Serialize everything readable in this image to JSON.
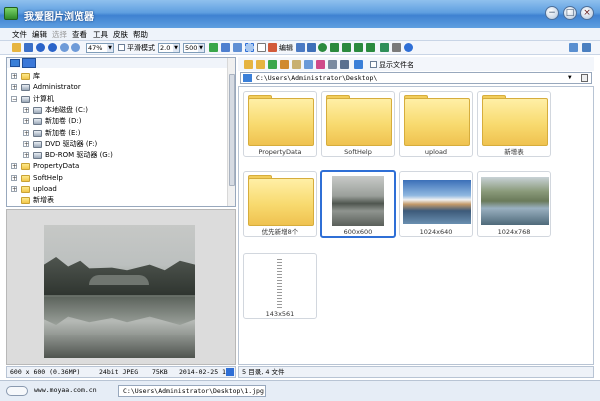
{
  "window": {
    "title": "我爱图片浏览器",
    "controls": [
      "−",
      "□",
      "×"
    ]
  },
  "menu": [
    {
      "label": "文件",
      "disabled": false
    },
    {
      "label": "编辑",
      "disabled": false
    },
    {
      "label": "选择",
      "disabled": true
    },
    {
      "label": "查看",
      "disabled": false
    },
    {
      "label": "工具",
      "disabled": false
    },
    {
      "label": "皮肤",
      "disabled": false
    },
    {
      "label": "帮助",
      "disabled": false
    }
  ],
  "toolbar": {
    "zoom_value": "47%",
    "smooth_label": "平滑模式",
    "num1_value": "2.0",
    "num2_value": "500",
    "edit_label": "编辑"
  },
  "tree": {
    "items": [
      {
        "label": "库",
        "level": 0,
        "icon": "folder-icon",
        "toggle": "+"
      },
      {
        "label": "Administrator",
        "level": 0,
        "icon": "user-icon",
        "toggle": "+"
      },
      {
        "label": "计算机",
        "level": 0,
        "icon": "computer-icon",
        "toggle": "−"
      },
      {
        "label": "本地磁盘 (C:)",
        "level": 1,
        "icon": "drive-icon",
        "toggle": "+"
      },
      {
        "label": "新加卷 (D:)",
        "level": 1,
        "icon": "drive-icon",
        "toggle": "+"
      },
      {
        "label": "新加卷 (E:)",
        "level": 1,
        "icon": "drive-icon",
        "toggle": "+"
      },
      {
        "label": "DVD 驱动器 (F:)",
        "level": 1,
        "icon": "dvd-icon",
        "toggle": "+"
      },
      {
        "label": "BD-ROM 驱动器 (G:)",
        "level": 1,
        "icon": "bdrom-icon",
        "toggle": "+"
      },
      {
        "label": "PropertyData",
        "level": 0,
        "icon": "folder-icon",
        "toggle": "+"
      },
      {
        "label": "SoftHelp",
        "level": 0,
        "icon": "folder-icon",
        "toggle": "+"
      },
      {
        "label": "upload",
        "level": 0,
        "icon": "folder-icon",
        "toggle": "+"
      },
      {
        "label": "新增表",
        "level": 0,
        "icon": "folder-icon",
        "toggle": ""
      }
    ]
  },
  "status": {
    "dimensions": "600 x 600 (0.36MP)",
    "depth": "24bit JPEG",
    "size": "75KB",
    "date": "2014-02-25 1",
    "summary": "5 目录, 4 文件"
  },
  "bottom": {
    "website": "www.moyaa.com.cn",
    "file_path": "C:\\Users\\Administrator\\Desktop\\1.jpg"
  },
  "browser": {
    "show_filename_label": "显示文件名",
    "path": "C:\\Users\\Administrator\\Desktop\\"
  },
  "thumbnails": [
    {
      "label": "PropertyData",
      "kind": "folder"
    },
    {
      "label": "SoftHelp",
      "kind": "folder"
    },
    {
      "label": "upload",
      "kind": "folder"
    },
    {
      "label": "新增表",
      "kind": "folder"
    },
    {
      "label": "优先新增8个",
      "kind": "folder"
    },
    {
      "label": "600x600",
      "kind": "image",
      "selected": true
    },
    {
      "label": "1024x640",
      "kind": "image"
    },
    {
      "label": "1024x768",
      "kind": "image"
    },
    {
      "label": "143x561",
      "kind": "image"
    }
  ]
}
